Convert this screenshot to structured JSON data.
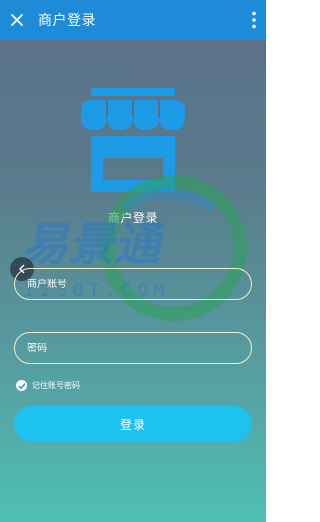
{
  "header": {
    "title": "商户登录",
    "back_icon": "close-icon",
    "menu_icon": "more-vert-icon",
    "background": "#1d8bd8"
  },
  "hero": {
    "icon": "storefront-icon",
    "label": "商户登录",
    "icon_color": "#1e9be6"
  },
  "watermark": {
    "brand": "易景通",
    "domain": "1230T.COM"
  },
  "form": {
    "account_placeholder": "商户账号",
    "password_placeholder": "密码",
    "remember_label": "记住账号密码",
    "remember_checked": true,
    "login_label": "登录",
    "button_color": "#1ec2ee"
  },
  "prev_icon": "chevron-left-icon"
}
